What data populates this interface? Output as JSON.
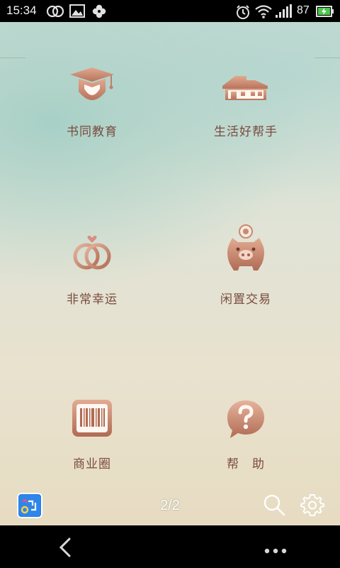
{
  "status_bar": {
    "time": "15:34",
    "battery_level": "87",
    "icons": [
      "dual-circle-icon",
      "image-icon",
      "clover-icon",
      "alarm-icon",
      "wifi-icon",
      "signal-icon",
      "battery-charging-icon"
    ]
  },
  "tiles": [
    {
      "label": "书同教育",
      "icon": "graduation-cap-icon"
    },
    {
      "label": "生活好帮手",
      "icon": "house-icon"
    },
    {
      "label": "非常幸运",
      "icon": "rings-icon"
    },
    {
      "label": "闲置交易",
      "icon": "piggy-bank-icon"
    },
    {
      "label": "商业圈",
      "icon": "barcode-icon"
    },
    {
      "label": "帮　助",
      "icon": "help-bubble-icon"
    }
  ],
  "bottom_bar": {
    "page_indicator": "2/2"
  },
  "colors": {
    "icon_copper": "#c98a72",
    "label_brown": "#7a4b3e"
  }
}
